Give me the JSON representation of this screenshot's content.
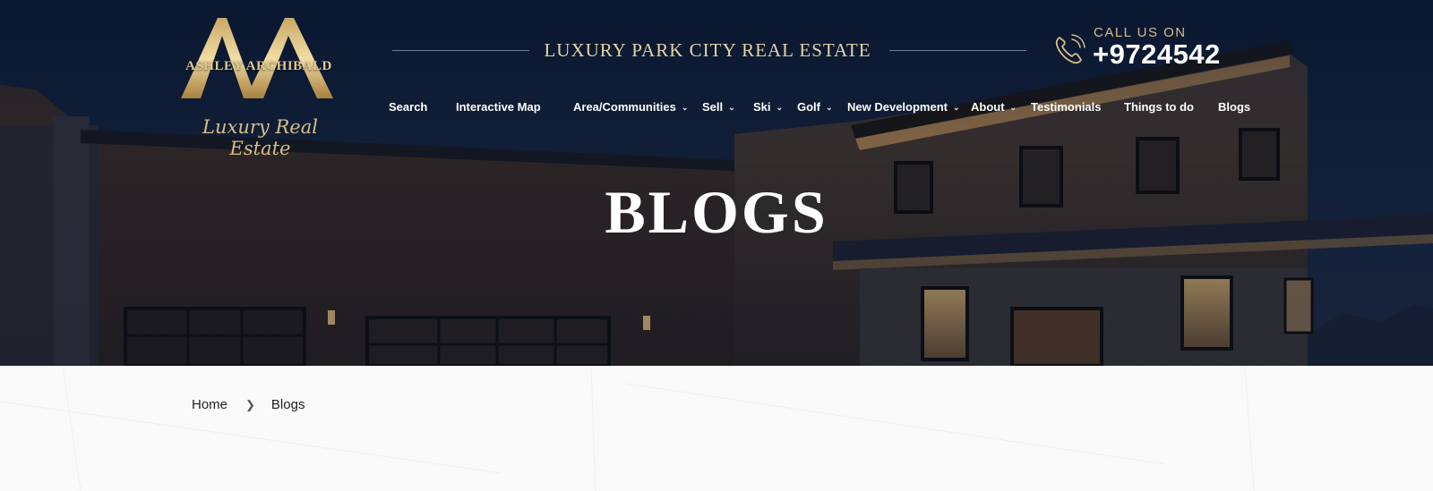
{
  "logo": {
    "name": "ASHLEY ARCHIBALD",
    "tagline": "Luxury Real Estate"
  },
  "header": {
    "tagline": "LUXURY PARK CITY REAL ESTATE",
    "call_label": "CALL US ON",
    "phone": "+9724542"
  },
  "nav": {
    "items": [
      {
        "label": "Search"
      },
      {
        "label": "Interactive Map"
      },
      {
        "label": "Area/Communities",
        "dropdown": true
      },
      {
        "label": "Sell",
        "dropdown": true
      },
      {
        "label": "Ski",
        "dropdown": true
      },
      {
        "label": "Golf",
        "dropdown": true
      },
      {
        "label": "New Development",
        "dropdown": true
      },
      {
        "label": "About",
        "dropdown": true
      },
      {
        "label": "Testimonials"
      },
      {
        "label": "Things to do"
      },
      {
        "label": "Blogs"
      }
    ]
  },
  "hero": {
    "title": "BLOGS"
  },
  "breadcrumb": {
    "home": "Home",
    "current": "Blogs",
    "separator_icon": "chevron-right-icon"
  },
  "colors": {
    "gold": "#d7bd87",
    "navy": "#0f1c33",
    "white": "#ffffff"
  }
}
